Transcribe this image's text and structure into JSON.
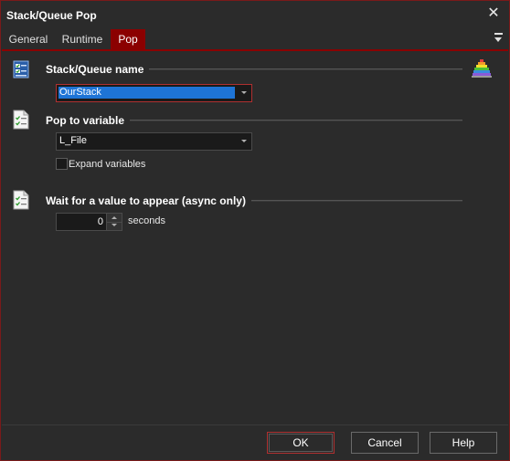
{
  "window": {
    "title": "Stack/Queue Pop",
    "close_glyph": "✕"
  },
  "tabs": [
    {
      "label": "General",
      "active": false
    },
    {
      "label": "Runtime",
      "active": false
    },
    {
      "label": "Pop",
      "active": true
    }
  ],
  "sections": {
    "stack_queue": {
      "label": "Stack/Queue name",
      "icon": "list-icon",
      "value": "OurStack",
      "side_icon": "stack-pyramid-icon"
    },
    "pop_to_variable": {
      "label": "Pop to variable",
      "icon": "document-check-icon",
      "value": "L_File",
      "expand_variables_label": "Expand variables",
      "expand_variables_checked": false
    },
    "wait": {
      "label": "Wait for a value to appear (async only)",
      "icon": "document-check-icon",
      "value": "0",
      "unit_label": "seconds"
    }
  },
  "footer": {
    "ok_label": "OK",
    "cancel_label": "Cancel",
    "help_label": "Help"
  },
  "colors": {
    "background": "#2b2b2b",
    "accent": "#8b0000",
    "selection": "#1e74d6"
  }
}
